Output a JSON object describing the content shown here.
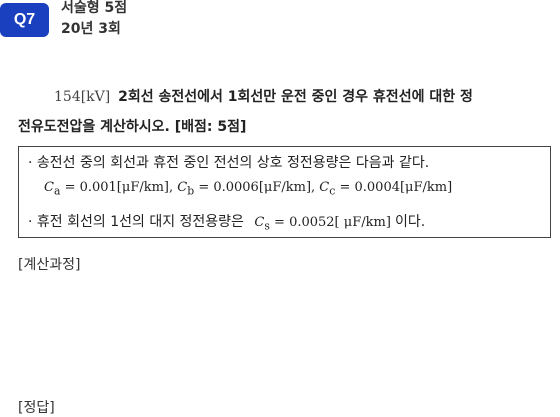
{
  "header": {
    "badge": "Q7",
    "type_label": "서술형 5점",
    "source": "20년 3회"
  },
  "question": {
    "prefix": "154[kV]",
    "line1": "2회선 송전선에서 1회선만 운전 중인 경우 휴전선에 대한 정",
    "line2": "전유도전압을 계산하시오. [배점: 5점]"
  },
  "given": {
    "line1": "· 송전선 중의 회선과 휴전 중인 전선의 상호 정전용량은 다음과 같다.",
    "ca_sub": "a",
    "ca_val": "= 0.001[μF/km],",
    "cb_sub": "b",
    "cb_val": "= 0.0006[μF/km],",
    "cc_sub": "c",
    "cc_val": "= 0.0004[μF/km]",
    "line3_text": "· 휴전 회선의 1선의 대지 정전용량은",
    "cs_sub": "s",
    "cs_val": "= 0.0052[ μF/km]",
    "line3_end": "이다."
  },
  "labels": {
    "calc": "[계산과정]",
    "answer": "[정답]"
  }
}
